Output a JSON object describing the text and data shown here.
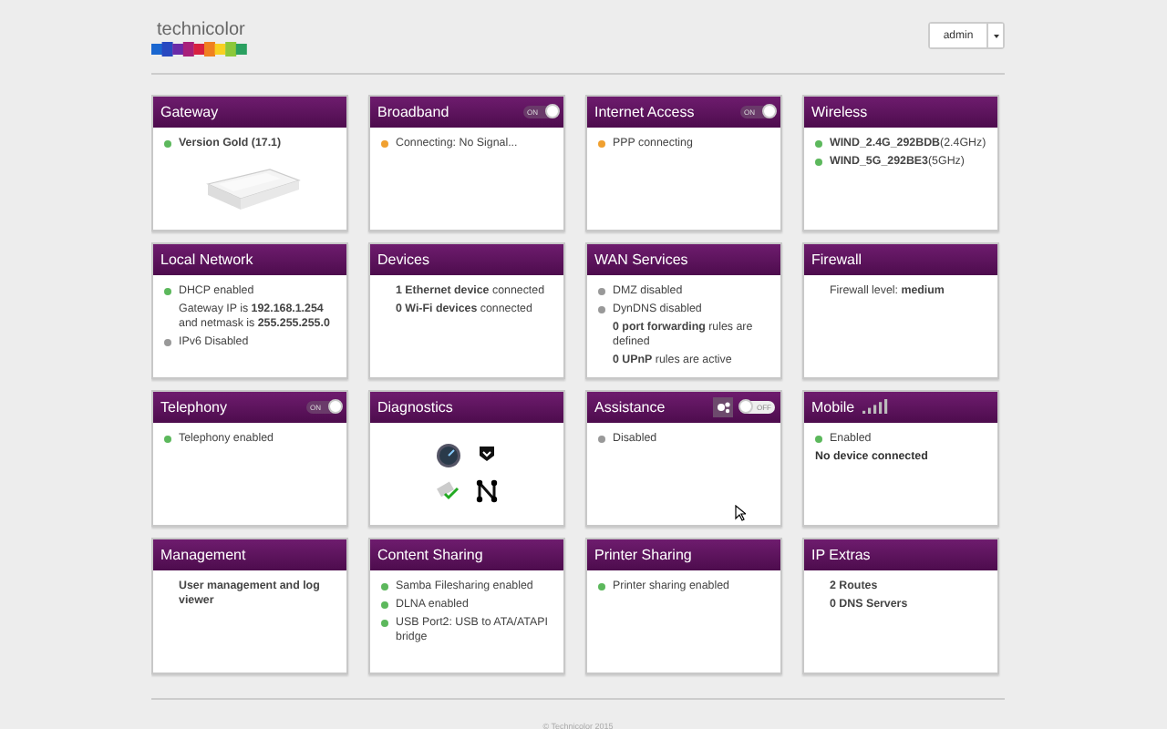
{
  "header": {
    "logo": "technicolor",
    "user_button": "admin"
  },
  "cards": [
    {
      "title": "Gateway",
      "kind": "picture",
      "lines": [
        {
          "kind": "status",
          "color": "#5cb85c",
          "text": "**Version Gold (17.1)**"
        }
      ]
    },
    {
      "title": "Broadband",
      "toggle": {
        "label": "ON",
        "on": true
      },
      "kind": "text",
      "lines": [
        {
          "kind": "status",
          "color": "#f0a030",
          "text": "Connecting: No Signal..."
        }
      ]
    },
    {
      "title": "Internet Access",
      "toggle": {
        "label": "ON",
        "on": true
      },
      "kind": "text",
      "lines": [
        {
          "kind": "status",
          "color": "#f0a030",
          "text": "PPP connecting"
        }
      ]
    },
    {
      "title": "Wireless",
      "kind": "text",
      "lines": [
        {
          "kind": "status",
          "color": "#5cb85c",
          "text": "**WIND_2.4G_292BDB**(2.4GHz)"
        },
        {
          "kind": "status",
          "color": "#5cb85c",
          "text": "**WIND_5G_292BE3**(5GHz)"
        }
      ]
    },
    {
      "title": "Local Network",
      "kind": "text",
      "lines": [
        {
          "kind": "status",
          "color": "#5cb85c",
          "text": "DHCP enabled"
        },
        {
          "kind": "sub",
          "text": "Gateway IP is **192.168.1.254** and netmask is **255.255.255.0**"
        },
        {
          "kind": "status",
          "color": "#999999",
          "text": "IPv6 Disabled"
        }
      ]
    },
    {
      "title": "Devices",
      "kind": "text",
      "lines": [
        {
          "kind": "plain",
          "text": "**1 Ethernet device** connected"
        },
        {
          "kind": "plain",
          "text": "**0 Wi-Fi devices** connected"
        }
      ]
    },
    {
      "title": "WAN Services",
      "kind": "text",
      "lines": [
        {
          "kind": "status",
          "color": "#999999",
          "text": "DMZ disabled"
        },
        {
          "kind": "status",
          "color": "#999999",
          "text": "DynDNS disabled"
        },
        {
          "kind": "sub",
          "text": "**0 port forwarding** rules are defined"
        },
        {
          "kind": "sub",
          "text": "**0 UPnP** rules are active"
        }
      ]
    },
    {
      "title": "Firewall",
      "kind": "text",
      "lines": [
        {
          "kind": "plain",
          "text": "Firewall level: **medium**"
        }
      ]
    },
    {
      "title": "Telephony",
      "toggle": {
        "label": "ON",
        "on": true
      },
      "kind": "text",
      "lines": [
        {
          "kind": "status",
          "color": "#5cb85c",
          "text": "Telephony enabled"
        }
      ]
    },
    {
      "title": "Diagnostics",
      "kind": "icons"
    },
    {
      "title": "Assistance",
      "settings": true,
      "toggle": {
        "label": "OFF",
        "on": false
      },
      "kind": "cursor",
      "lines": [
        {
          "kind": "status",
          "color": "#999999",
          "text": "Disabled"
        }
      ]
    },
    {
      "title": "Mobile",
      "signal": true,
      "kind": "text",
      "lines": [
        {
          "kind": "status",
          "color": "#5cb85c",
          "text": "Enabled"
        },
        {
          "kind": "bold",
          "text": "No device connected"
        }
      ]
    },
    {
      "title": "Management",
      "kind": "text",
      "lines": [
        {
          "kind": "plain",
          "text": "**User management and log viewer**"
        }
      ]
    },
    {
      "title": "Content Sharing",
      "kind": "text",
      "lines": [
        {
          "kind": "status",
          "color": "#5cb85c",
          "text": "Samba Filesharing enabled"
        },
        {
          "kind": "status",
          "color": "#5cb85c",
          "text": "DLNA enabled"
        },
        {
          "kind": "status",
          "color": "#5cb85c",
          "text": "USB Port2: USB to ATA/ATAPI bridge"
        }
      ]
    },
    {
      "title": "Printer Sharing",
      "kind": "text",
      "lines": [
        {
          "kind": "status",
          "color": "#5cb85c",
          "text": "Printer sharing enabled"
        }
      ]
    },
    {
      "title": "IP Extras",
      "kind": "text",
      "lines": [
        {
          "kind": "plain",
          "text": "**2 Routes**"
        },
        {
          "kind": "plain",
          "text": "**0 DNS Servers**"
        }
      ]
    }
  ],
  "footer": "© Technicolor 2015"
}
